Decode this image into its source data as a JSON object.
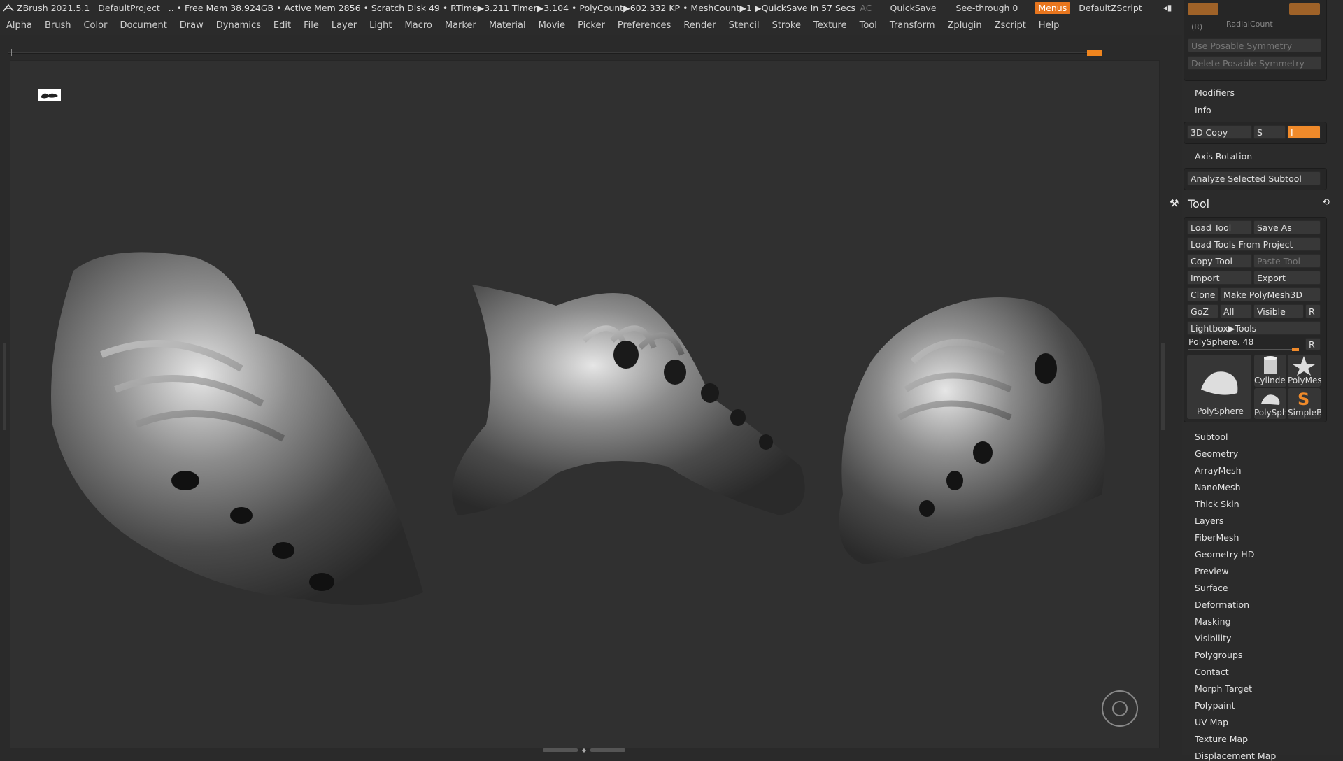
{
  "titlebar": {
    "app": "ZBrush 2021.5.1",
    "project": "DefaultProject",
    "status": ".. • Free Mem 38.924GB • Active Mem 2856 • Scratch Disk 49 •  RTime▶3.211 Timer▶3.104 • PolyCount▶602.332 KP  • MeshCount▶1  ▶QuickSave In 57 Secs",
    "ac": "AC",
    "quicksave": "QuickSave",
    "seethrough": "See-through   0",
    "menus": "Menus",
    "script": "DefaultZScript"
  },
  "menu": [
    "Alpha",
    "Brush",
    "Color",
    "Document",
    "Draw",
    "Dynamics",
    "Edit",
    "File",
    "Layer",
    "Light",
    "Macro",
    "Marker",
    "Material",
    "Movie",
    "Picker",
    "Preferences",
    "Render",
    "Stencil",
    "Stroke",
    "Texture",
    "Tool",
    "Transform",
    "Zplugin",
    "Zscript",
    "Help"
  ],
  "panel": {
    "radial_label": "(R)",
    "radial": "RadialCount",
    "use_posable": "Use Posable Symmetry",
    "delete_posable": "Delete Posable Symmetry",
    "modifiers": "Modifiers",
    "info": "Info",
    "copy3d": "3D Copy",
    "s": "S",
    "i": "I",
    "axis_rotation": "Axis Rotation",
    "analyze": "Analyze Selected Subtool",
    "tool": "Tool",
    "load_tool": "Load Tool",
    "save_as": "Save As",
    "load_project": "Load Tools From Project",
    "copy_tool": "Copy Tool",
    "paste_tool": "Paste Tool",
    "import": "Import",
    "export": "Export",
    "clone": "Clone",
    "make_polymesh": "Make PolyMesh3D",
    "goz": "GoZ",
    "all": "All",
    "visible": "Visible",
    "r": "R",
    "lightbox": "Lightbox▶Tools",
    "polysphere_slider": "PolySphere. 48",
    "thumbs": [
      "PolySphere",
      "Cylinder",
      "PolyMes",
      "PolySph",
      "SimpleB"
    ],
    "sections": [
      "Subtool",
      "Geometry",
      "ArrayMesh",
      "NanoMesh",
      "Thick Skin",
      "Layers",
      "FiberMesh",
      "Geometry HD",
      "Preview",
      "Surface",
      "Deformation",
      "Masking",
      "Visibility",
      "Polygroups",
      "Contact",
      "Morph Target",
      "Polypaint",
      "UV Map",
      "Texture Map",
      "Displacement Map"
    ]
  }
}
